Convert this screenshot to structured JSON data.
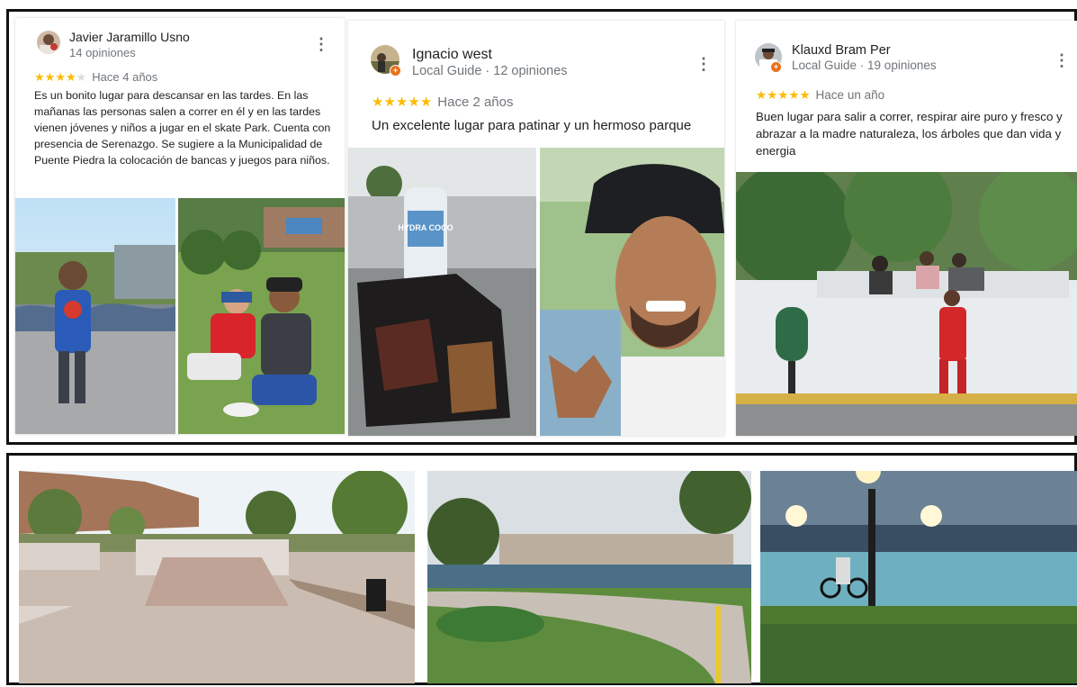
{
  "reviews": [
    {
      "author": "Javier Jaramillo Usno",
      "meta": "14 opiniones",
      "rating": 4,
      "time": "Hace 4 años",
      "text": "Es un bonito lugar para descansar en las tardes. En las mañanas las personas salen a correr en él y en las tardes vienen jóvenes y niños a jugar en el skate Park. Cuenta con presencia de Serenazgo. Se sugiere a la Municipalidad de Puente Piedra la colocación de bancas y juegos para niños."
    },
    {
      "author": "Ignacio west",
      "meta": "Local Guide · 12 opiniones",
      "rating": 5,
      "time": "Hace 2 años",
      "text": "Un excelente lugar para patinar y un hermoso parque"
    },
    {
      "author": "Klauxd Bram Per",
      "meta": "Local Guide · 19 opiniones",
      "rating": 5,
      "time": "Hace un año",
      "text": "Buen lugar para salir a correr, respirar aire puro y fresco y abrazar a la madre naturaleza, los árboles que dan vida y energia"
    }
  ],
  "review_photos": {
    "bottle_label": "HYDRA COCO"
  },
  "icons": {
    "more": "more-vert-icon",
    "star": "star-icon",
    "local_guide_badge": "local-guide-badge-icon"
  },
  "colors": {
    "star": "#fbbc04",
    "star_empty": "#dadce0",
    "badge": "#e8711c",
    "frame": "#111111"
  }
}
